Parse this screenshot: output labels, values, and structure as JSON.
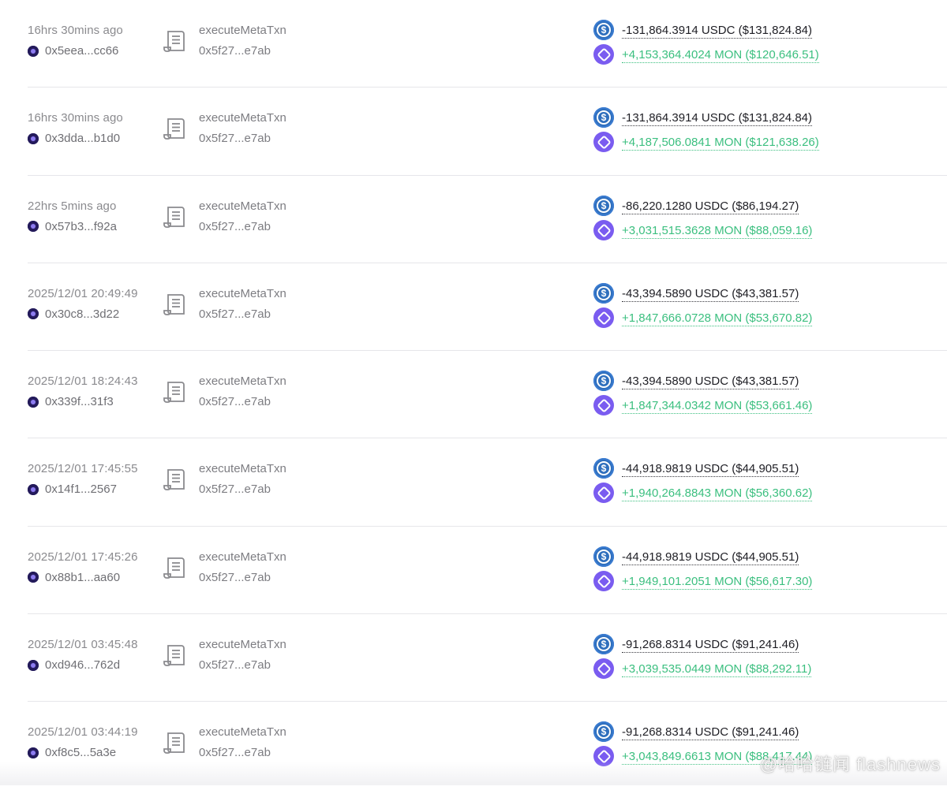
{
  "transactions": [
    {
      "time": "16hrs 30mins ago",
      "address": "0x5eea...cc66",
      "method": "executeMetaTxn",
      "contract": "0x5f27...e7ab",
      "out_amount": "-131,864.3914 USDC ($131,824.84)",
      "in_amount": "+4,153,364.4024 MON ($120,646.51)"
    },
    {
      "time": "16hrs 30mins ago",
      "address": "0x3dda...b1d0",
      "method": "executeMetaTxn",
      "contract": "0x5f27...e7ab",
      "out_amount": "-131,864.3914 USDC ($131,824.84)",
      "in_amount": "+4,187,506.0841 MON ($121,638.26)"
    },
    {
      "time": "22hrs 5mins ago",
      "address": "0x57b3...f92a",
      "method": "executeMetaTxn",
      "contract": "0x5f27...e7ab",
      "out_amount": "-86,220.1280 USDC ($86,194.27)",
      "in_amount": "+3,031,515.3628 MON ($88,059.16)"
    },
    {
      "time": "2025/12/01 20:49:49",
      "address": "0x30c8...3d22",
      "method": "executeMetaTxn",
      "contract": "0x5f27...e7ab",
      "out_amount": "-43,394.5890 USDC ($43,381.57)",
      "in_amount": "+1,847,666.0728 MON ($53,670.82)"
    },
    {
      "time": "2025/12/01 18:24:43",
      "address": "0x339f...31f3",
      "method": "executeMetaTxn",
      "contract": "0x5f27...e7ab",
      "out_amount": "-43,394.5890 USDC ($43,381.57)",
      "in_amount": "+1,847,344.0342 MON ($53,661.46)"
    },
    {
      "time": "2025/12/01 17:45:55",
      "address": "0x14f1...2567",
      "method": "executeMetaTxn",
      "contract": "0x5f27...e7ab",
      "out_amount": "-44,918.9819 USDC ($44,905.51)",
      "in_amount": "+1,940,264.8843 MON ($56,360.62)"
    },
    {
      "time": "2025/12/01 17:45:26",
      "address": "0x88b1...aa60",
      "method": "executeMetaTxn",
      "contract": "0x5f27...e7ab",
      "out_amount": "-44,918.9819 USDC ($44,905.51)",
      "in_amount": "+1,949,101.2051 MON ($56,617.30)"
    },
    {
      "time": "2025/12/01 03:45:48",
      "address": "0xd946...762d",
      "method": "executeMetaTxn",
      "contract": "0x5f27...e7ab",
      "out_amount": "-91,268.8314 USDC ($91,241.46)",
      "in_amount": "+3,039,535.0449 MON ($88,292.11)"
    },
    {
      "time": "2025/12/01 03:44:19",
      "address": "0xf8c5...5a3e",
      "method": "executeMetaTxn",
      "contract": "0x5f27...e7ab",
      "out_amount": "-91,268.8314 USDC ($91,241.46)",
      "in_amount": "+3,043,849.6613 MON ($88,417.44)"
    }
  ],
  "icons": {
    "address": "address-avatar-icon",
    "method": "document-icon",
    "token_out": "usdc-token-icon",
    "token_in": "mon-token-icon"
  },
  "colors": {
    "amount_in": "#3bbf7f",
    "amount_out": "#1e1e24",
    "muted_text": "#7d7d82",
    "usdc": "#2f6fbd",
    "mon": "#7a5cf0"
  },
  "watermark": "@哈哈链闻 flashnews"
}
